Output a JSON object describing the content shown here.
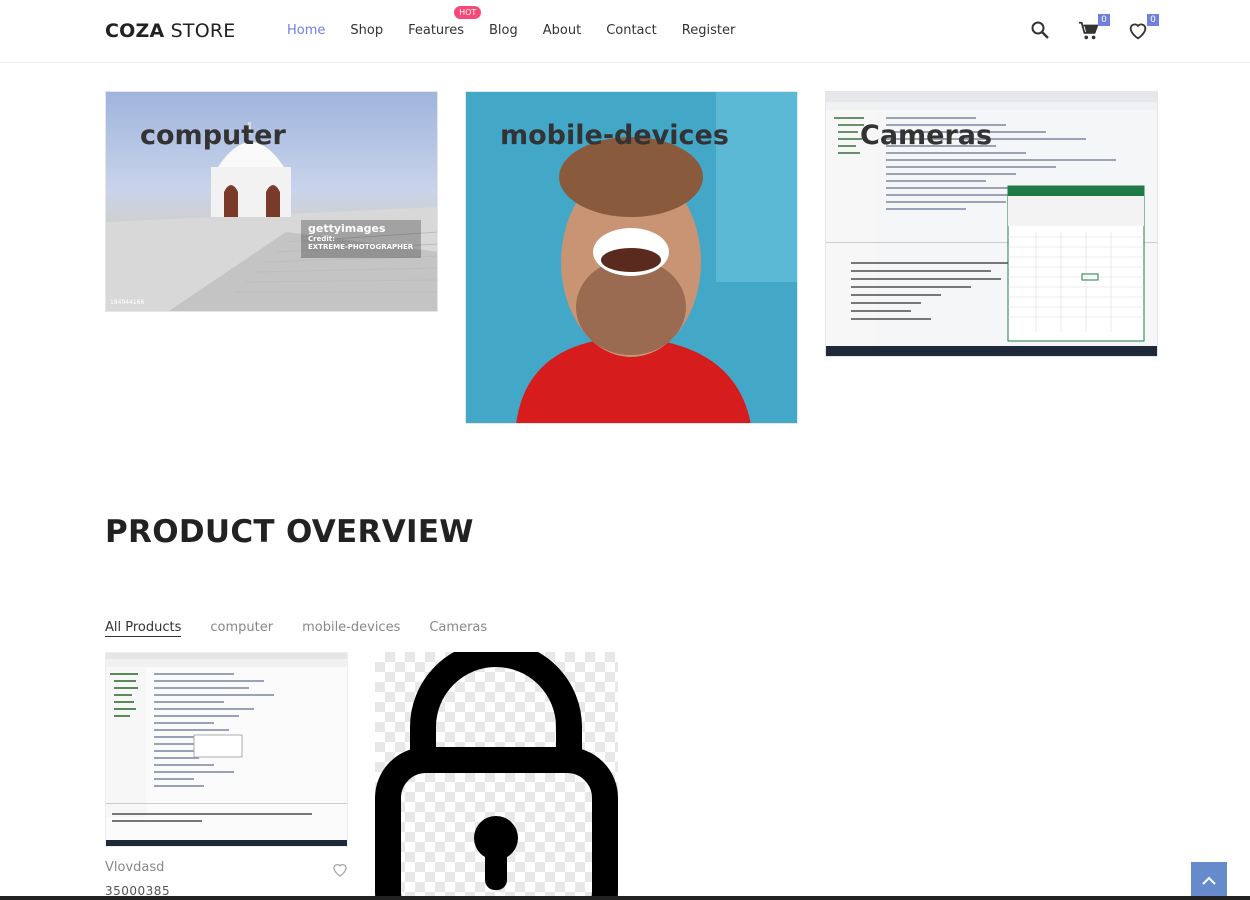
{
  "header": {
    "logo_bold": "COZA",
    "logo_rest": " STORE",
    "nav": [
      {
        "label": "Home"
      },
      {
        "label": "Shop"
      },
      {
        "label": "Features"
      },
      {
        "label": "Blog"
      },
      {
        "label": "About"
      },
      {
        "label": "Contact"
      },
      {
        "label": "Register"
      }
    ],
    "hot_badge": "HOT",
    "cart_count": "0",
    "wishlist_count": "0",
    "accent_color": "#717fe0"
  },
  "banners": [
    {
      "label": "computer",
      "image_credit_brand": "gettyimages",
      "image_credit_line1": "Credit:",
      "image_credit_line2": "EXTREME-PHOTOGRAPHER",
      "image_id": "184944166"
    },
    {
      "label": "mobile-devices"
    },
    {
      "label": "Cameras"
    }
  ],
  "section": {
    "title": "PRODUCT OVERVIEW",
    "filters": [
      {
        "label": "All Products"
      },
      {
        "label": "computer"
      },
      {
        "label": "mobile-devices"
      },
      {
        "label": "Cameras"
      }
    ]
  },
  "products": [
    {
      "name": "Vlovdasd",
      "price": "35000385",
      "image": "code-editor-screenshot"
    },
    {
      "image": "lock-icon"
    }
  ]
}
